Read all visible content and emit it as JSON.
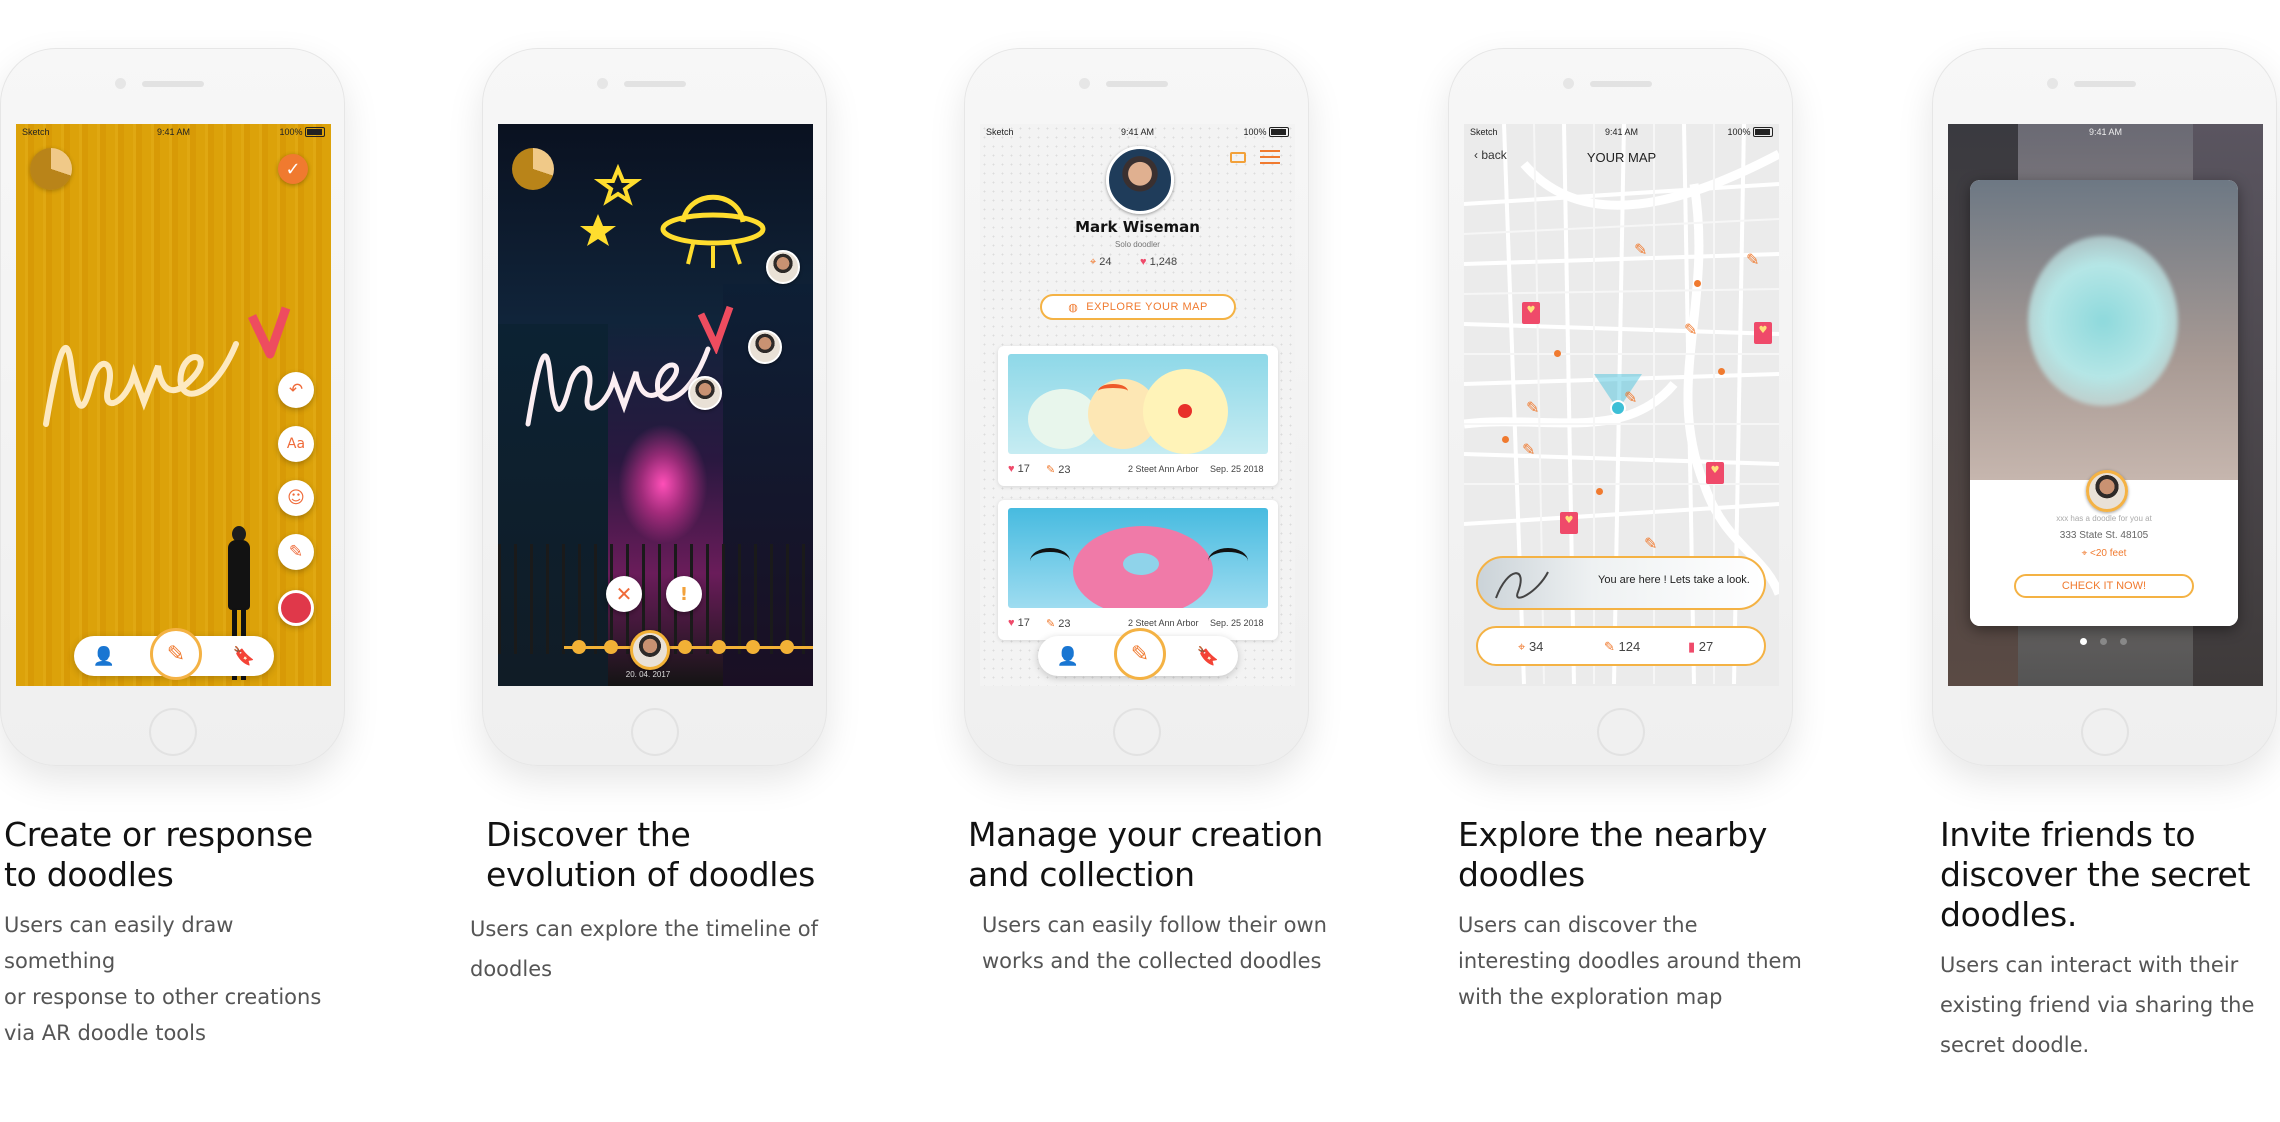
{
  "colors": {
    "accent": "#f4b244",
    "accent_dark": "#f07a2f",
    "pink": "#ef4a6a",
    "text": "#111111",
    "body": "#555555"
  },
  "status_bar": {
    "carrier": "Sketch",
    "time": "9:41 AM",
    "battery": "100%"
  },
  "screen1": {
    "doodle_text": "love",
    "tools": [
      "undo-icon",
      "Aa",
      "emoji-icon",
      "brush-icon",
      "color-icon"
    ]
  },
  "screen2": {
    "doodle_text": "love",
    "date": "20. 04. 2017"
  },
  "screen3": {
    "name": "Mark Wiseman",
    "subtitle": "Solo doodler",
    "locations": "24",
    "likes": "1,248",
    "explore_button": "EXPLORE YOUR MAP",
    "cards": [
      {
        "likes": "17",
        "doodles": "23",
        "address": "2 Steet Ann Arbor",
        "date": "Sep. 25 2018"
      },
      {
        "likes": "17",
        "doodles": "23",
        "address": "2 Steet Ann Arbor",
        "date": "Sep. 25 2018"
      }
    ]
  },
  "screen4": {
    "back": "back",
    "title": "YOUR MAP",
    "here_text": "You are here ! Lets take a look.",
    "places": "34",
    "doodles": "124",
    "bookmarks": "27"
  },
  "screen5": {
    "invite_text": "xxx has a doodle for you at",
    "address": "333 State St. 48105",
    "distance": "<20 feet",
    "check_button": "CHECK IT NOW!"
  },
  "captions": [
    {
      "title": "Create or response\n to doodles",
      "body": [
        "Users can easily draw something",
        "or response to other creations",
        "via AR doodle tools"
      ]
    },
    {
      "title": "Discover the\nevolution of doodles",
      "body": [
        "Users can explore the timeline of",
        "doodles"
      ]
    },
    {
      "title": "Manage your creation\nand collection",
      "body": [
        "Users can easily follow their own",
        "works and the collected doodles"
      ]
    },
    {
      "title": "Explore the nearby\ndoodles",
      "body": [
        "Users can discover the",
        "interesting doodles around them",
        "with the exploration map"
      ]
    },
    {
      "title": "Invite friends to\ndiscover the secret\ndoodles.",
      "body": [
        "Users can interact with their",
        "existing friend via sharing the",
        "secret doodle."
      ]
    }
  ]
}
